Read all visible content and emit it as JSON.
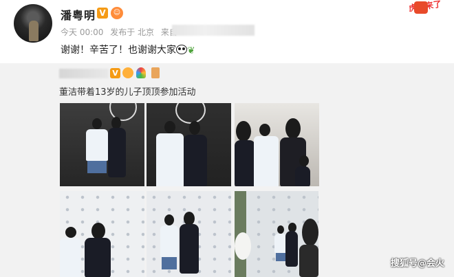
{
  "post": {
    "username": "潘粤明",
    "verified_badge": "V",
    "meta_time": "今天 00:00",
    "meta_published": "发布于 北京",
    "meta_source_prefix": "来自",
    "text": "谢谢！辛苦了！也谢谢大家",
    "corner_stamp": "虎气来了"
  },
  "repost": {
    "verified_badge": "V",
    "text": "董洁带着13岁的儿子顶顶参加活动",
    "photos": [
      "photo-1",
      "photo-2",
      "photo-3",
      "photo-4",
      "photo-5",
      "photo-6"
    ]
  },
  "watermark": "搜狐号@会火",
  "colors": {
    "badge_orange": "#f59b16",
    "page_bg": "#f2f2f2"
  }
}
